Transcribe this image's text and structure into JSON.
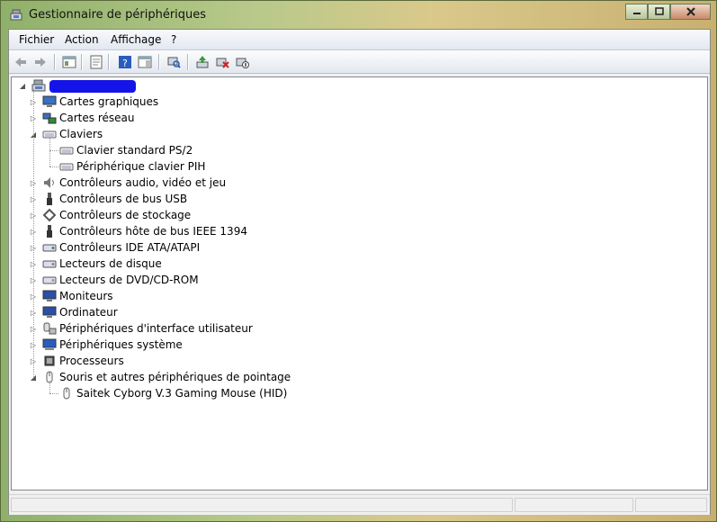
{
  "window": {
    "title": "Gestionnaire de périphériques",
    "title_icon": "device-manager-icon"
  },
  "caption": {
    "minimize_icon": "minimize-icon",
    "maximize_icon": "maximize-icon",
    "close_icon": "close-icon"
  },
  "menu": {
    "items": [
      "Fichier",
      "Action",
      "Affichage",
      "?"
    ]
  },
  "toolbar": {
    "buttons": [
      "back-icon",
      "forward-icon",
      "show-hide-console-tree-icon",
      "properties-icon",
      "help-icon",
      "show-action-pane-icon",
      "scan-hardware-icon",
      "update-driver-icon",
      "uninstall-icon",
      "disable-icon"
    ]
  },
  "tree": {
    "root": {
      "label": "",
      "icon": "computer-root-icon",
      "redacted": true
    },
    "categories": [
      {
        "label": "Cartes graphiques",
        "icon": "display-adapter-icon",
        "expanded": false
      },
      {
        "label": "Cartes réseau",
        "icon": "network-adapter-icon",
        "expanded": false
      },
      {
        "label": "Claviers",
        "icon": "keyboard-icon",
        "expanded": true,
        "children": [
          {
            "label": "Clavier standard PS/2",
            "icon": "keyboard-device-icon"
          },
          {
            "label": "Périphérique clavier PIH",
            "icon": "keyboard-device-icon"
          }
        ]
      },
      {
        "label": "Contrôleurs audio, vidéo et jeu",
        "icon": "audio-icon",
        "expanded": false
      },
      {
        "label": "Contrôleurs de bus USB",
        "icon": "usb-icon",
        "expanded": false
      },
      {
        "label": "Contrôleurs de stockage",
        "icon": "storage-controller-icon",
        "expanded": false
      },
      {
        "label": "Contrôleurs hôte de bus IEEE 1394",
        "icon": "ieee1394-icon",
        "expanded": false
      },
      {
        "label": "Contrôleurs IDE ATA/ATAPI",
        "icon": "ide-controller-icon",
        "expanded": false
      },
      {
        "label": "Lecteurs de disque",
        "icon": "disk-drive-icon",
        "expanded": false
      },
      {
        "label": "Lecteurs de DVD/CD-ROM",
        "icon": "dvd-drive-icon",
        "expanded": false
      },
      {
        "label": "Moniteurs",
        "icon": "monitor-icon",
        "expanded": false
      },
      {
        "label": "Ordinateur",
        "icon": "computer-icon",
        "expanded": false
      },
      {
        "label": "Périphériques d'interface utilisateur",
        "icon": "hid-icon",
        "expanded": false
      },
      {
        "label": "Périphériques système",
        "icon": "system-device-icon",
        "expanded": false
      },
      {
        "label": "Processeurs",
        "icon": "processor-icon",
        "expanded": false
      },
      {
        "label": "Souris et autres périphériques de pointage",
        "icon": "mouse-icon",
        "expanded": true,
        "children": [
          {
            "label": "Saitek Cyborg V.3 Gaming Mouse (HID)",
            "icon": "mouse-device-icon"
          }
        ]
      }
    ]
  }
}
